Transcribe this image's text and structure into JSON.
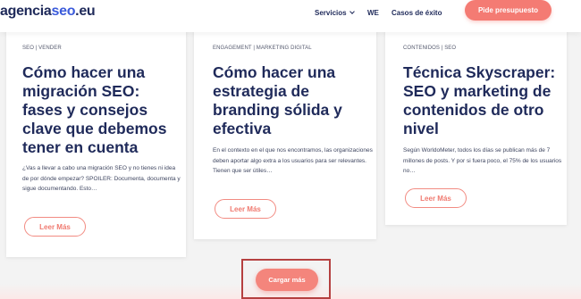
{
  "header": {
    "logo_pre": "agencia",
    "logo_seo": "seo",
    "logo_post": ".eu",
    "nav": [
      {
        "label": "Servicios",
        "has_dropdown": true
      },
      {
        "label": "WE"
      },
      {
        "label": "Casos de éxito"
      }
    ],
    "cta_label": "Pide presupuesto"
  },
  "cards": [
    {
      "tags": "SEO | VENDER",
      "title": "Cómo hacer una migración SEO: fases y consejos clave que debemos tener en cuenta",
      "excerpt": "¿Vas a llevar a cabo una migración SEO y no tienes ni idea de por dónde empezar? SPOILER: Documenta, documenta y sigue documentando. Esto…",
      "button": "Leer Más"
    },
    {
      "tags": "ENGAGEMENT | MARKETING DIGITAL",
      "title": "Cómo hacer una estrategia de branding sólida y efectiva",
      "excerpt": "En el contexto en el que nos encontramos, las organizaciones deben aportar algo extra a los usuarios para ser relevantes. Tienen que ser útiles…",
      "button": "Leer Más"
    },
    {
      "tags": "CONTENIDOS | SEO",
      "title": "Técnica Skyscraper: SEO y marketing de contenidos de otro nivel",
      "excerpt": "Según WorldoMeter, todos los días se publican más de 7 millones de posts. Y por si fuera poco, el 75% de los usuarios no…",
      "button": "Leer Más"
    }
  ],
  "load_more": "Cargar más",
  "colors": {
    "navy": "#1f2a5a",
    "accent": "#f47b73",
    "highlight_border": "#b54040"
  }
}
